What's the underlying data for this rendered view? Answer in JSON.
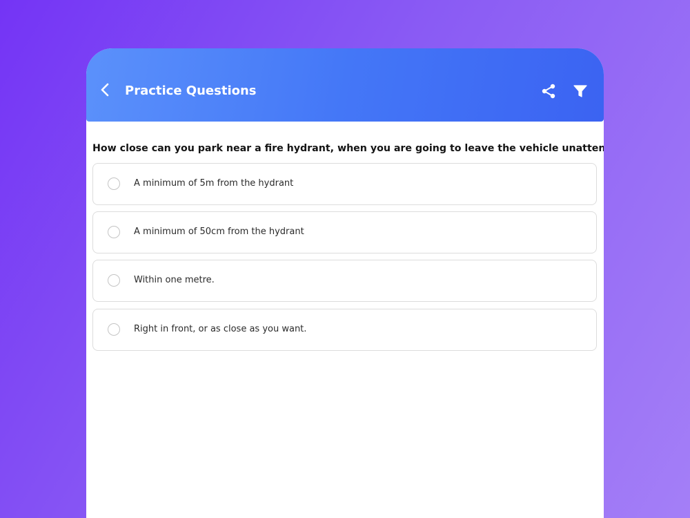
{
  "header": {
    "title": "Practice Questions",
    "back_icon": "chevron-left-icon",
    "share_icon": "share-icon",
    "filter_icon": "filter-icon"
  },
  "question": {
    "text": "How close can you park near a fire hydrant, when you are going to leave the vehicle unattended?",
    "options": [
      {
        "label": "A minimum of 5m from the hydrant",
        "selected": false
      },
      {
        "label": "A minimum of 50cm from the hydrant",
        "selected": false
      },
      {
        "label": "Within one metre.",
        "selected": false
      },
      {
        "label": "Right in front, or as close as you want.",
        "selected": false
      }
    ]
  },
  "colors": {
    "header_start": "#5b91fb",
    "header_end": "#3b63f2",
    "background_start": "#7434f5",
    "background_end": "#a47ff7"
  }
}
